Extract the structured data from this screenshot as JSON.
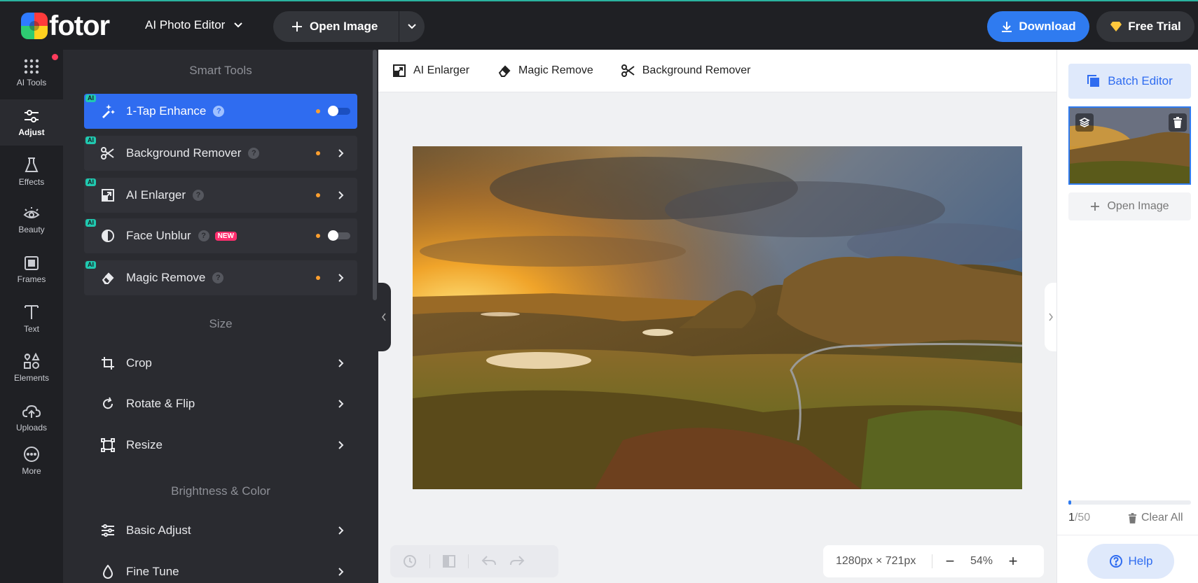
{
  "topbar": {
    "logo_text": "fotor",
    "editor_label": "AI Photo Editor",
    "open_image_label": "Open Image",
    "download_label": "Download",
    "free_trial_label": "Free Trial"
  },
  "rail": {
    "items": [
      {
        "label": "AI Tools",
        "icon": "grid-dots-icon"
      },
      {
        "label": "Adjust",
        "icon": "sliders-icon"
      },
      {
        "label": "Effects",
        "icon": "flask-icon"
      },
      {
        "label": "Beauty",
        "icon": "eye-icon"
      },
      {
        "label": "Frames",
        "icon": "frame-icon"
      },
      {
        "label": "Text",
        "icon": "text-icon"
      },
      {
        "label": "Elements",
        "icon": "shapes-icon"
      },
      {
        "label": "Uploads",
        "icon": "cloud-upload-icon"
      },
      {
        "label": "More",
        "icon": "more-icon"
      }
    ]
  },
  "panel": {
    "smart_tools_title": "Smart Tools",
    "size_title": "Size",
    "brightness_title": "Brightness & Color",
    "ai_badge": "AI",
    "new_badge": "NEW",
    "help_mark": "?",
    "smart_tools": [
      {
        "label": "1-Tap Enhance",
        "icon": "magic-wand-icon",
        "active": true,
        "control": "toggle",
        "toggle_on": false
      },
      {
        "label": "Background Remover",
        "icon": "scissors-icon",
        "control": "chevron"
      },
      {
        "label": "AI Enlarger",
        "icon": "enlarge-icon",
        "control": "chevron"
      },
      {
        "label": "Face Unblur",
        "icon": "face-unblur-icon",
        "control": "toggle",
        "toggle_on": false,
        "new": true
      },
      {
        "label": "Magic Remove",
        "icon": "eraser-icon",
        "control": "chevron"
      }
    ],
    "size_tools": [
      {
        "label": "Crop",
        "icon": "crop-icon"
      },
      {
        "label": "Rotate & Flip",
        "icon": "rotate-icon"
      },
      {
        "label": "Resize",
        "icon": "resize-icon"
      }
    ],
    "color_tools": [
      {
        "label": "Basic Adjust",
        "icon": "sliders-icon"
      },
      {
        "label": "Fine Tune",
        "icon": "droplet-icon"
      }
    ]
  },
  "subtoolbar": {
    "items": [
      {
        "label": "AI Enlarger",
        "icon": "enlarge-icon"
      },
      {
        "label": "Magic Remove",
        "icon": "eraser-icon"
      },
      {
        "label": "Background Remover",
        "icon": "scissors-icon"
      }
    ]
  },
  "canvas": {
    "dimensions": "1280px × 721px",
    "zoom": "54%",
    "zoom_minus": "−",
    "zoom_plus": "+"
  },
  "right_panel": {
    "batch_editor_label": "Batch Editor",
    "open_image_label": "Open Image",
    "count_current": "1",
    "count_total": "/50",
    "progress_fraction": 0.02,
    "clear_all_label": "Clear All",
    "help_label": "Help"
  },
  "colors": {
    "accent": "#2f7bf0",
    "dark_bg": "#1f2024",
    "panel_bg": "#2a2b30",
    "ai_badge": "#20c9b0",
    "new_badge": "#ff2e6e",
    "status_dot": "#ff9f2e"
  }
}
